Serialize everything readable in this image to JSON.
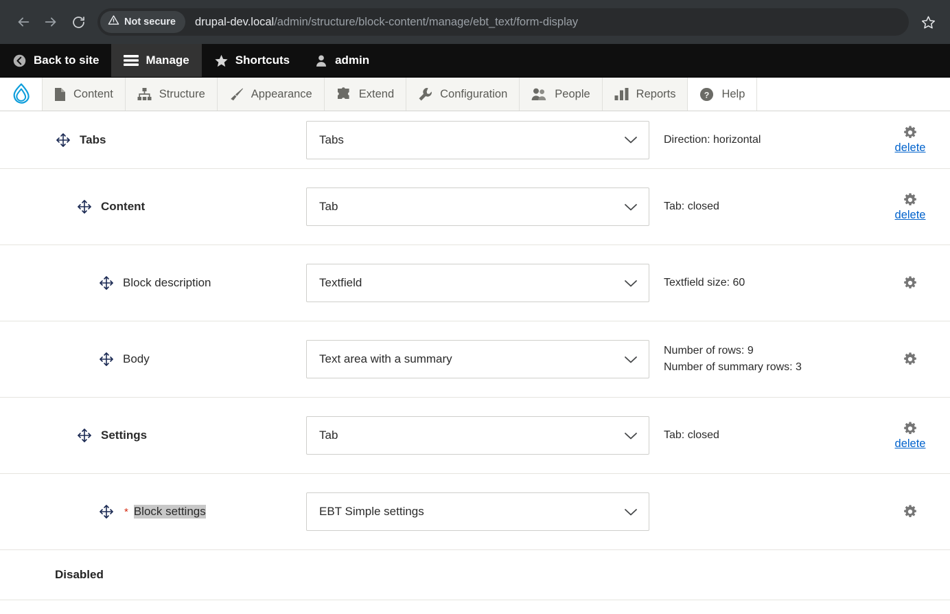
{
  "browser": {
    "back_icon": "back-arrow-icon",
    "forward_icon": "forward-arrow-icon",
    "reload_icon": "reload-icon",
    "security_warning_icon": "warning-triangle-icon",
    "security_label": "Not secure",
    "url_host": "drupal-dev.local",
    "url_path": "/admin/structure/block-content/manage/ebt_text/form-display",
    "bookmark_icon": "star-icon",
    "colors": {
      "chrome_bg": "#323639",
      "omnibox_bg": "#292b2d",
      "chip_bg": "#3c4043"
    }
  },
  "admin_toolbar": {
    "items": [
      {
        "label": "Back to site",
        "icon": "back-circle-icon",
        "active": false
      },
      {
        "label": "Manage",
        "icon": "hamburger-icon",
        "active": true
      },
      {
        "label": "Shortcuts",
        "icon": "star-icon",
        "active": false
      },
      {
        "label": "admin",
        "icon": "user-icon",
        "active": false
      }
    ]
  },
  "admin_menu": {
    "logo_icon": "drupal-drop-logo",
    "items": [
      {
        "label": "Content",
        "icon": "page-icon"
      },
      {
        "label": "Structure",
        "icon": "hierarchy-icon"
      },
      {
        "label": "Appearance",
        "icon": "paintbrush-icon"
      },
      {
        "label": "Extend",
        "icon": "puzzle-piece-icon"
      },
      {
        "label": "Configuration",
        "icon": "wrench-icon"
      },
      {
        "label": "People",
        "icon": "people-icon"
      },
      {
        "label": "Reports",
        "icon": "bar-chart-icon"
      },
      {
        "label": "Help",
        "icon": "question-circle-icon"
      }
    ]
  },
  "form_display": {
    "rows": [
      {
        "label": "Tabs",
        "bold": true,
        "required": false,
        "selected": false,
        "indent": 0,
        "widget": "Tabs",
        "summary": [
          "Direction: horizontal"
        ],
        "has_gear": true,
        "has_delete": true,
        "delete_label": "delete"
      },
      {
        "label": "Content",
        "bold": true,
        "required": false,
        "selected": false,
        "indent": 1,
        "widget": "Tab",
        "summary": [
          "Tab: closed"
        ],
        "has_gear": true,
        "has_delete": true,
        "delete_label": "delete"
      },
      {
        "label": "Block description",
        "bold": false,
        "required": false,
        "selected": false,
        "indent": 2,
        "widget": "Textfield",
        "summary": [
          "Textfield size: 60"
        ],
        "has_gear": true,
        "has_delete": false,
        "delete_label": ""
      },
      {
        "label": "Body",
        "bold": false,
        "required": false,
        "selected": false,
        "indent": 2,
        "widget": "Text area with a summary",
        "summary": [
          "Number of rows: 9",
          "Number of summary rows: 3"
        ],
        "has_gear": true,
        "has_delete": false,
        "delete_label": ""
      },
      {
        "label": "Settings",
        "bold": true,
        "required": false,
        "selected": false,
        "indent": 1,
        "widget": "Tab",
        "summary": [
          "Tab: closed"
        ],
        "has_gear": true,
        "has_delete": true,
        "delete_label": "delete"
      },
      {
        "label": "Block settings",
        "bold": false,
        "required": true,
        "selected": true,
        "indent": 2,
        "widget": "EBT Simple settings",
        "summary": [],
        "has_gear": true,
        "has_delete": false,
        "delete_label": ""
      }
    ],
    "disabled_section_label": "Disabled",
    "drag_handle_icon": "move-cross-arrows-icon",
    "gear_icon": "gear-icon",
    "chevron_icon": "chevron-down-icon",
    "colors": {
      "link": "#0062cc",
      "required_star": "#d5290f",
      "selection_highlight": "#c8c8c8",
      "row_border": "#e6e4df",
      "handle": "#1b2a53"
    }
  }
}
